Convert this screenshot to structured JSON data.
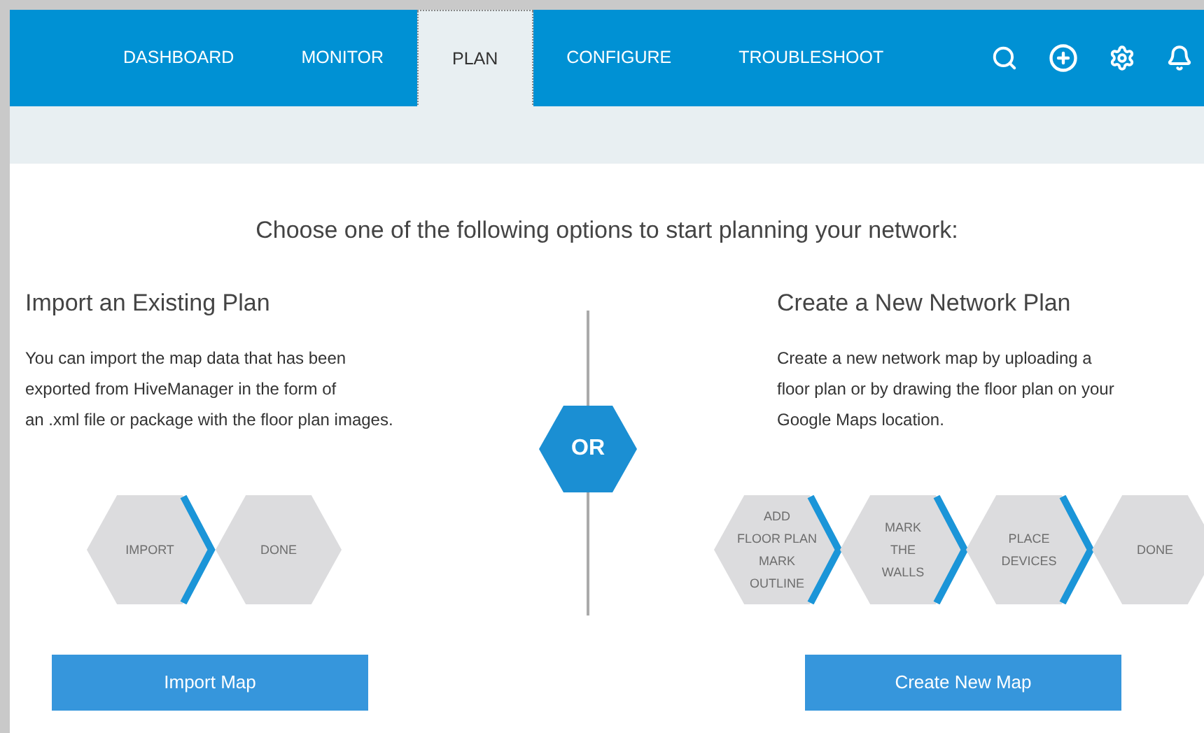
{
  "nav": {
    "tabs": [
      {
        "label": "DASHBOARD",
        "selected": false
      },
      {
        "label": "MONITOR",
        "selected": false
      },
      {
        "label": "PLAN",
        "selected": true
      },
      {
        "label": "CONFIGURE",
        "selected": false
      },
      {
        "label": "TROUBLESHOOT",
        "selected": false
      }
    ]
  },
  "title": "Choose one of the following options to start planning your network:",
  "options": [
    {
      "heading": "Import an Existing Plan",
      "description": "You can import the map data that has been\nexported from HiveManager in the form of\nan .xml file or package with the floor plan images.",
      "steps": [
        {
          "label": "IMPORT",
          "chevron": true
        },
        {
          "label": "DONE",
          "chevron": false
        }
      ],
      "button": "Import Map"
    },
    {
      "heading": "Create a New Network Plan",
      "description": "Create a new network map by uploading a\nfloor plan or by drawing the floor plan on your\nGoogle Maps location.",
      "steps": [
        {
          "label": "ADD\nFLOOR PLAN\nMARK\nOUTLINE",
          "chevron": true
        },
        {
          "label": "MARK\nTHE\nWALLS",
          "chevron": true
        },
        {
          "label": "PLACE\nDEVICES",
          "chevron": true
        },
        {
          "label": "DONE",
          "chevron": false
        }
      ],
      "button": "Create New Map"
    }
  ],
  "separator": "OR"
}
